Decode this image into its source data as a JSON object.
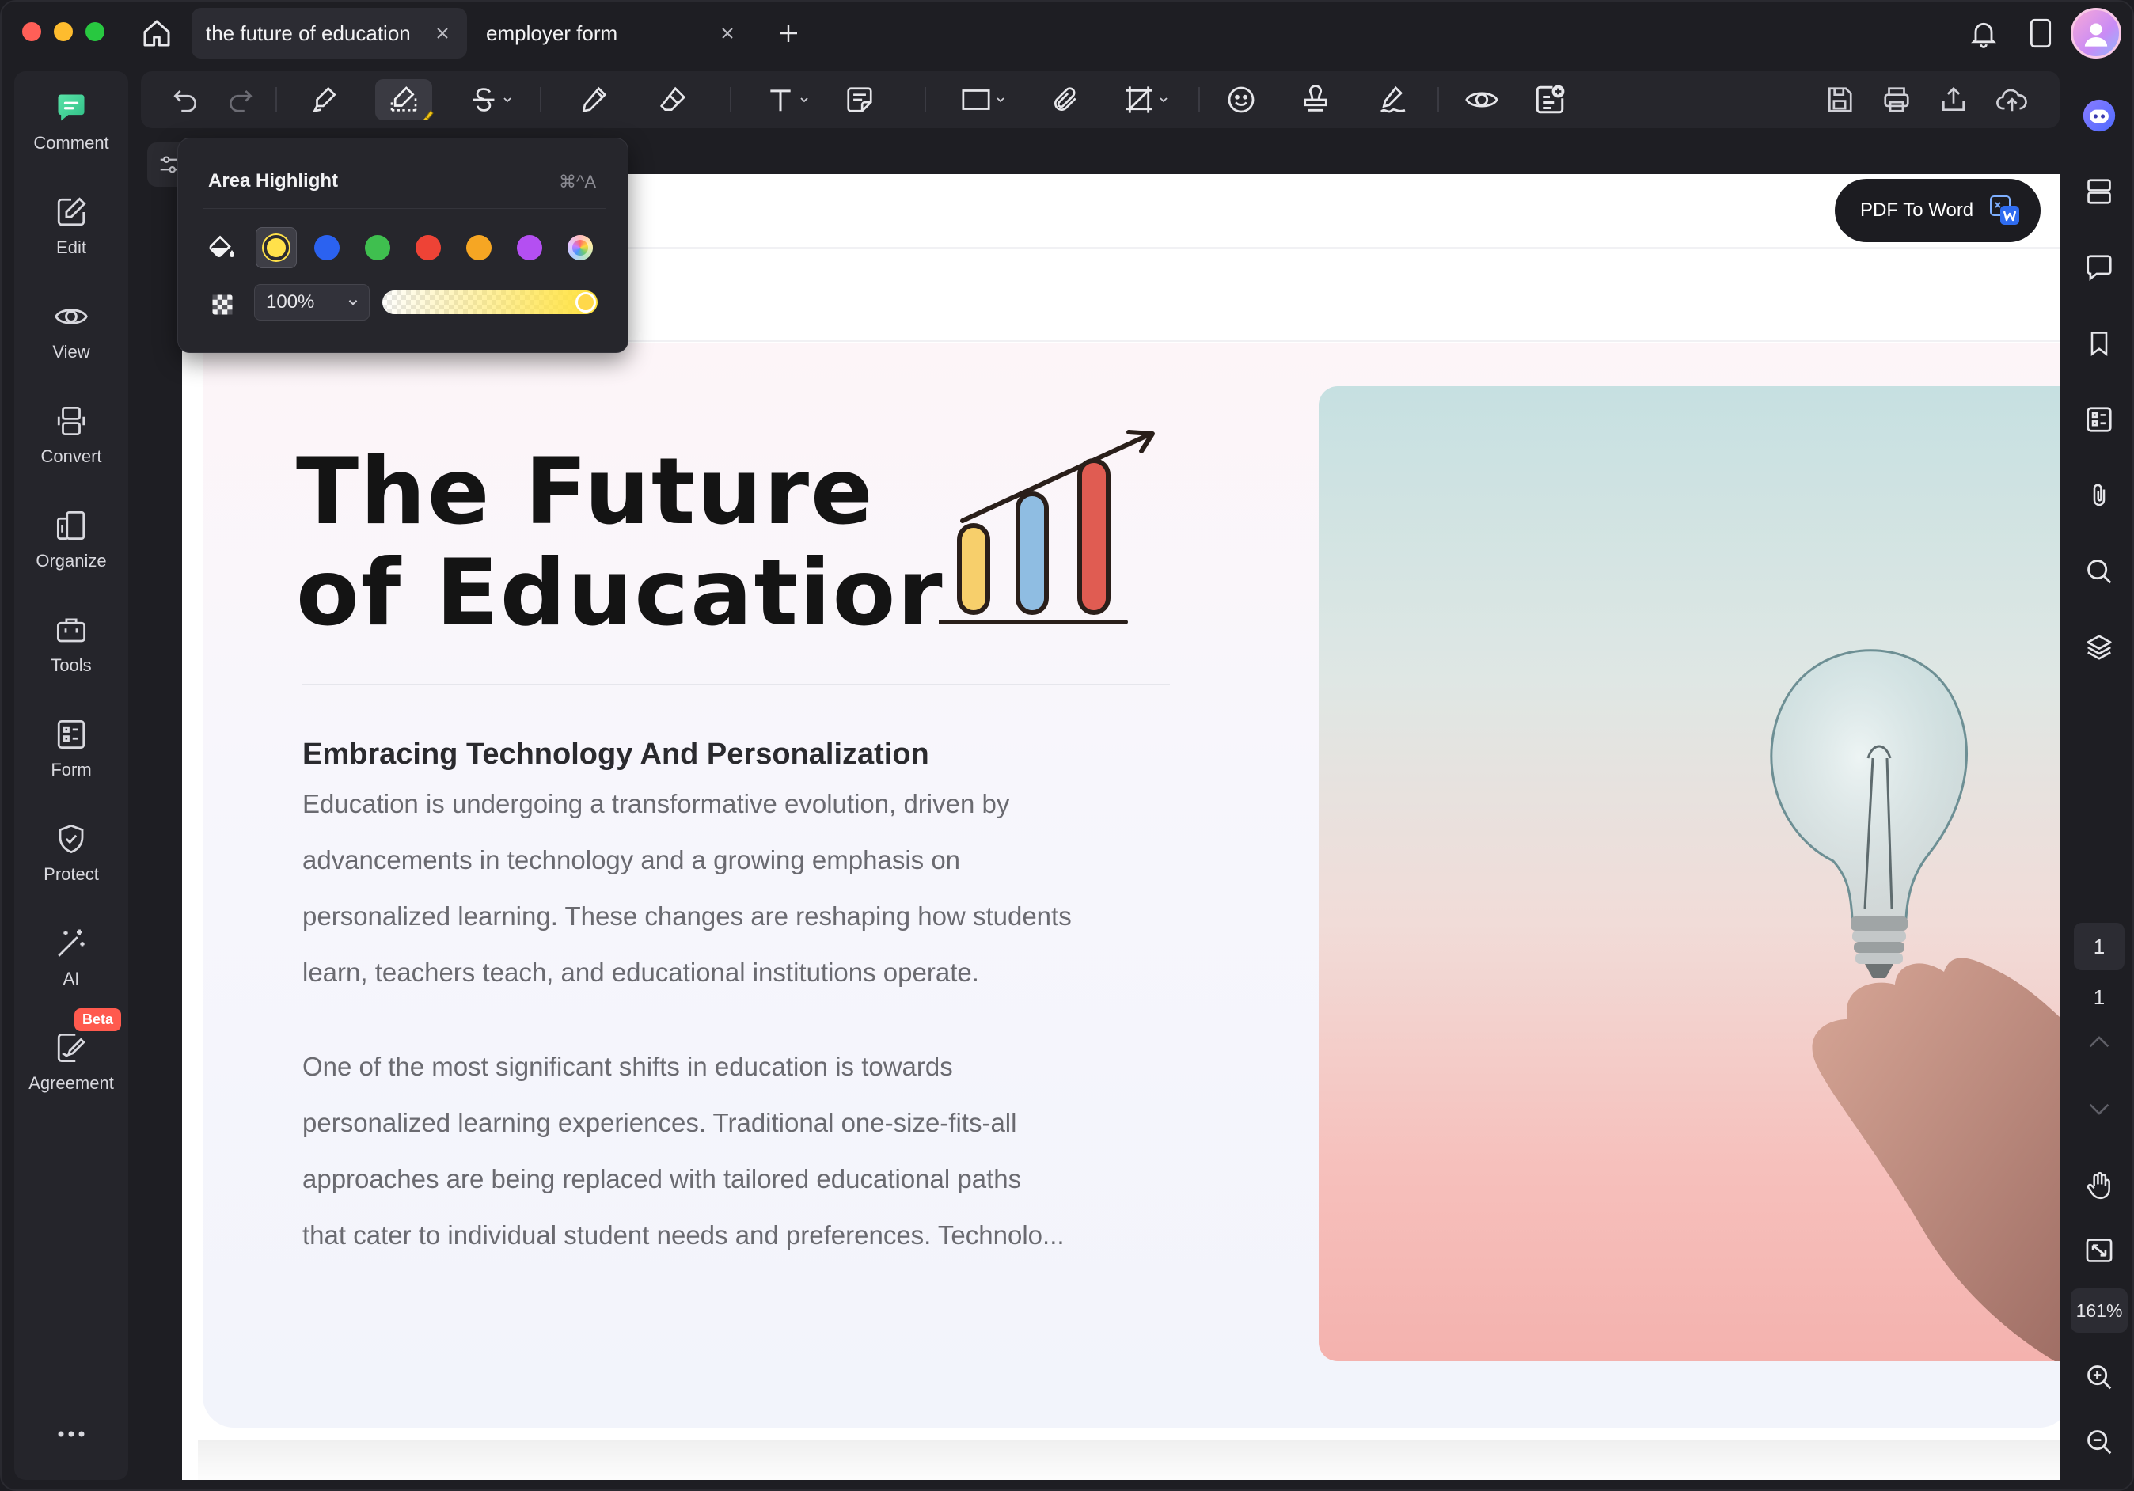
{
  "tabs": [
    {
      "label": "the future of education",
      "active": true
    },
    {
      "label": "employer form",
      "active": false
    }
  ],
  "left_sidebar": {
    "items": [
      {
        "label": "Comment",
        "icon": "comment-icon"
      },
      {
        "label": "Edit",
        "icon": "edit-icon"
      },
      {
        "label": "View",
        "icon": "view-icon"
      },
      {
        "label": "Convert",
        "icon": "convert-icon"
      },
      {
        "label": "Organize",
        "icon": "organize-icon"
      },
      {
        "label": "Tools",
        "icon": "tools-icon"
      },
      {
        "label": "Form",
        "icon": "form-icon"
      },
      {
        "label": "Protect",
        "icon": "protect-icon"
      },
      {
        "label": "AI",
        "icon": "ai-icon"
      },
      {
        "label": "Agreement",
        "icon": "agreement-icon"
      }
    ],
    "agreement_badge": "Beta"
  },
  "area_highlight": {
    "title": "Area Highlight",
    "shortcut": "⌘^A",
    "colors": [
      "#ffe14a",
      "#2b62f0",
      "#3fbf4f",
      "#ee4336",
      "#f6a623",
      "#b44ff2",
      "rainbow"
    ],
    "selected_color": "#ffe14a",
    "opacity_value": "100%",
    "opacity_fraction": 1.0
  },
  "pdf_to_word": {
    "label": "PDF To Word"
  },
  "document": {
    "title_line1": "The Future",
    "title_line2": "of Educatior",
    "subheading": "Embracing Technology And Personalization",
    "paragraph1_lines": [
      "Education is undergoing a transformative evolution, driven by",
      "advancements in technology and a growing emphasis on",
      "personalized learning. These changes are reshaping how students",
      "learn, teachers teach, and educational institutions operate."
    ],
    "paragraph2_lines": [
      "One of the most significant shifts in education is towards",
      "personalized learning experiences. Traditional one-size-fits-all",
      "approaches are being replaced with tailored educational paths",
      "that cater to individual student needs and preferences. Technolo..."
    ]
  },
  "right_rail": {
    "current_page": "1",
    "total_pages": "1",
    "zoom": "161%"
  },
  "colors": {
    "chart_bar_yellow": "#f7cf6b",
    "chart_bar_blue": "#8fbde2",
    "chart_bar_red": "#e05c52"
  }
}
